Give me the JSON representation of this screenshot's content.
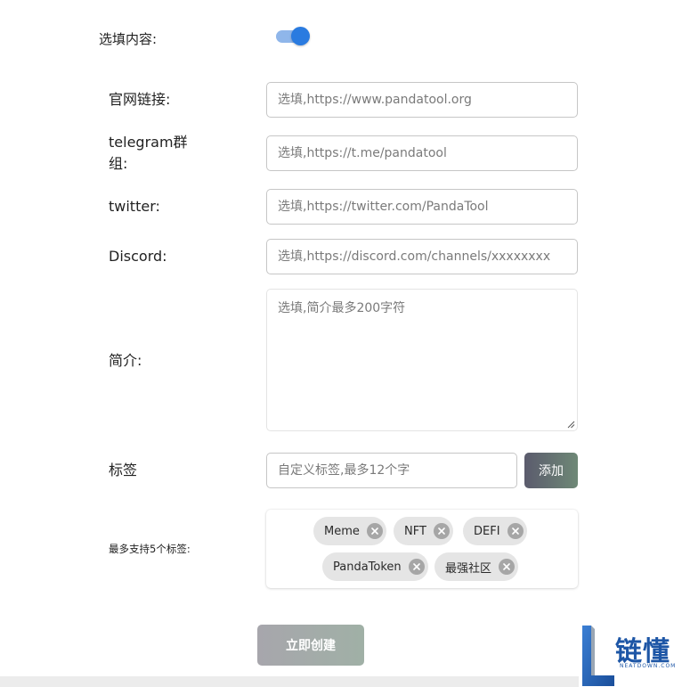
{
  "optional": {
    "label": "选填内容:",
    "toggle_on": true,
    "accent": "#2a7be0"
  },
  "fields": {
    "website": {
      "label": "官网链接:",
      "placeholder": "选填,https://www.pandatool.org"
    },
    "telegram": {
      "label_line1": "telegram群",
      "label_line2": "组:",
      "placeholder": "选填,https://t.me/pandatool"
    },
    "twitter": {
      "label": "twitter:",
      "placeholder": "选填,https://twitter.com/PandaTool"
    },
    "discord": {
      "label": "Discord:",
      "placeholder": "选填,https://discord.com/channels/xxxxxxxx"
    },
    "intro": {
      "label": "简介:",
      "placeholder": "选填,简介最多200字符"
    }
  },
  "tags": {
    "label": "标签",
    "input_placeholder": "自定义标签,最多12个字",
    "add_label": "添加",
    "limit_label": "最多支持5个标签:",
    "items": [
      "Meme",
      "NFT",
      "DEFI",
      "PandaToken",
      "最强社区"
    ]
  },
  "submit": {
    "label": "立即创建"
  },
  "watermark": {
    "text": "链懂",
    "subtext": "NEATDOWN.COM"
  }
}
